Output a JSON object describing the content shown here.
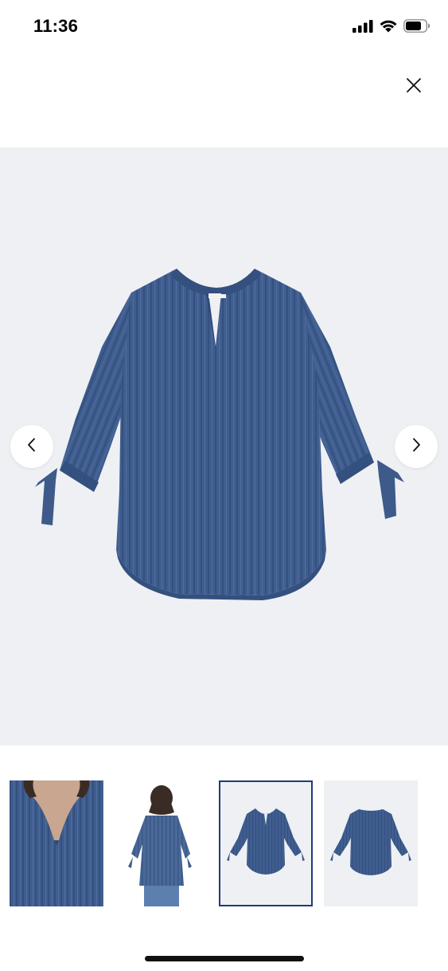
{
  "status_bar": {
    "time": "11:36",
    "icons": [
      "cellular-signal-icon",
      "wifi-icon",
      "battery-icon"
    ]
  },
  "viewer": {
    "close_icon": "close-icon",
    "prev_icon": "chevron-left-icon",
    "next_icon": "chevron-right-icon",
    "main_image": "blue-striped-blouse-front",
    "selected_index": 2
  },
  "thumbnails": [
    {
      "image": "blouse-neckline-closeup"
    },
    {
      "image": "blouse-back-on-model"
    },
    {
      "image": "blouse-front-flat"
    },
    {
      "image": "blouse-back-flat"
    }
  ],
  "colors": {
    "fabric": "#3f5d8e",
    "fabric_dark": "#2f4a78",
    "image_background": "#eef0f3",
    "selected_border": "#1f3c7a"
  }
}
